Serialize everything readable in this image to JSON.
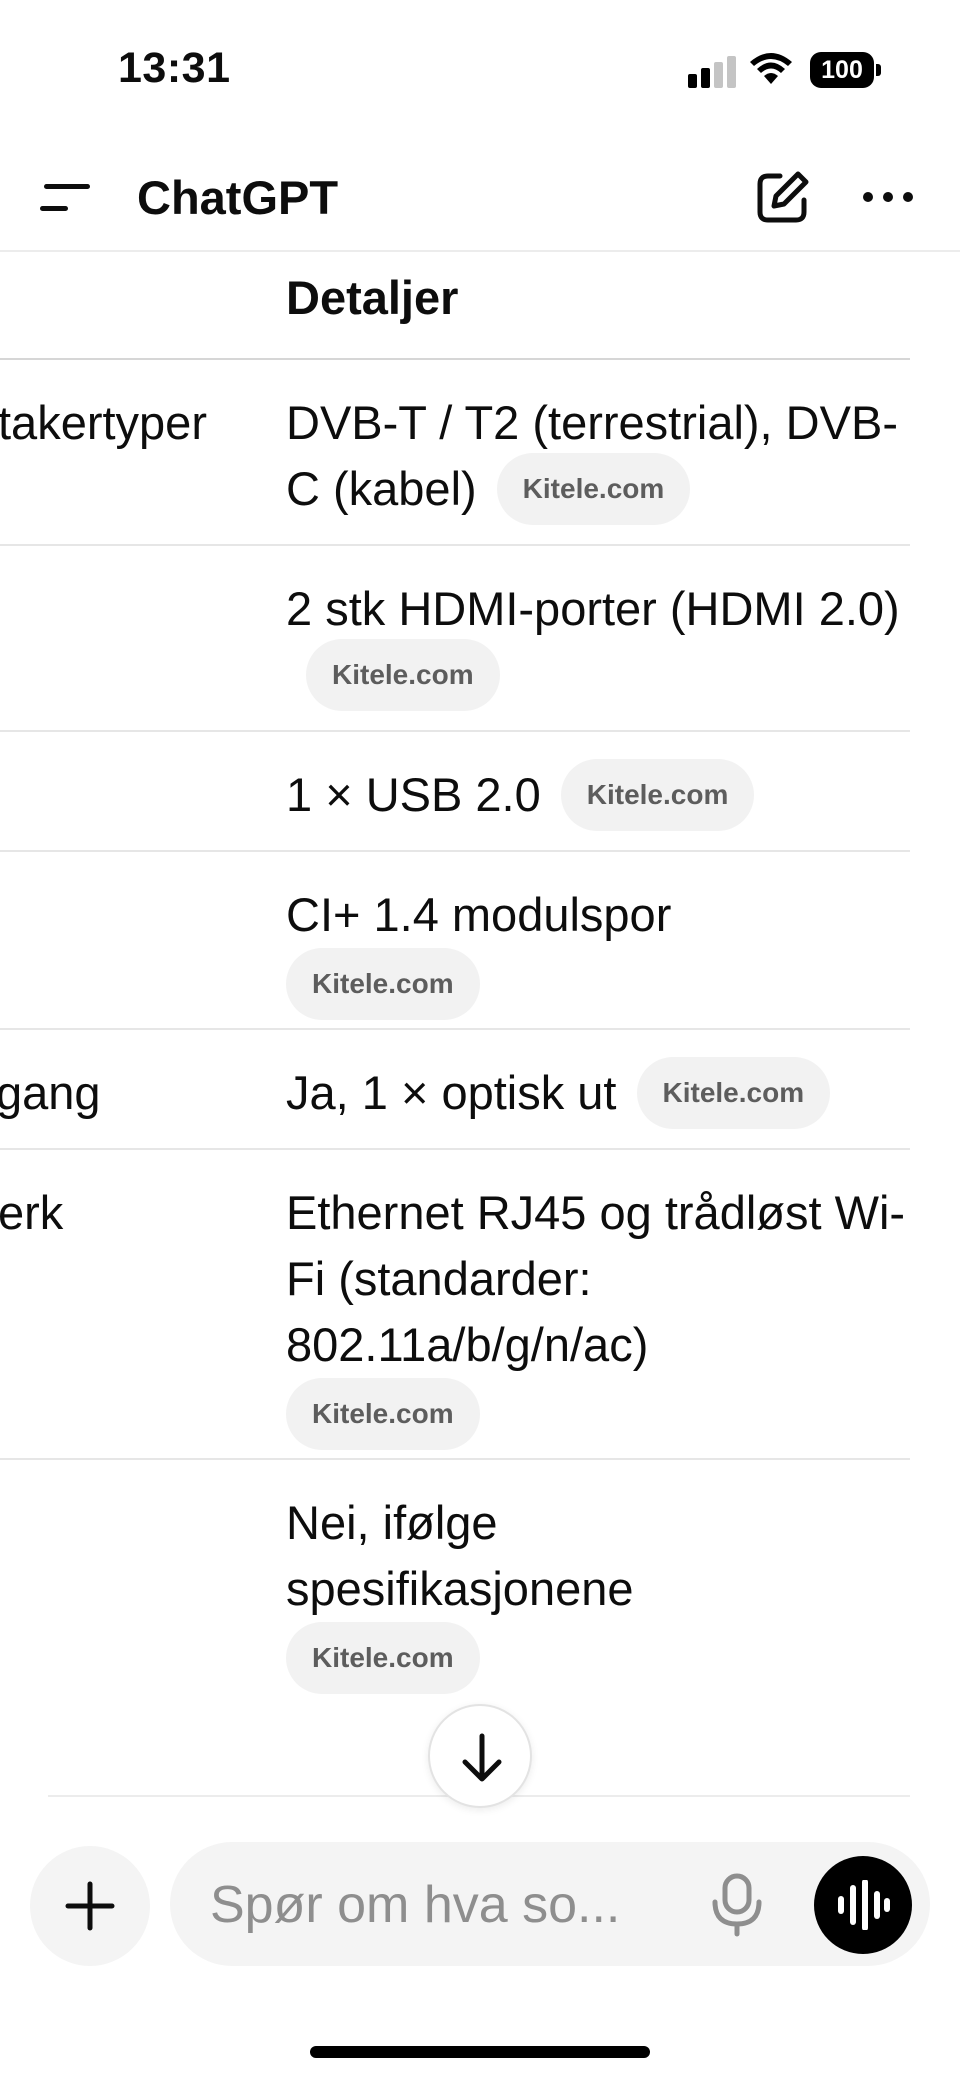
{
  "status_bar": {
    "time": "13:31",
    "battery": "100"
  },
  "header": {
    "title": "ChatGPT"
  },
  "table": {
    "details_header": "Detaljer",
    "rows": [
      {
        "label": "takertyper",
        "value": "DVB-T / T2 (terrestrial), DVB-C (kabel)",
        "source": "Kitele.com"
      },
      {
        "label": "",
        "value": "2 stk HDMI-porter (HDMI 2.0)",
        "source": "Kitele.com"
      },
      {
        "label": "",
        "value": "1 × USB 2.0",
        "source": "Kitele.com"
      },
      {
        "label": "",
        "value": "CI+ 1.4 modulspor",
        "source": "Kitele.com"
      },
      {
        "label": "gang",
        "value": "Ja, 1 × optisk ut",
        "source": "Kitele.com"
      },
      {
        "label": "erk",
        "value": "Ethernet RJ45 og trådløst Wi-Fi (standarder: 802.11a/b/g/n/ac)",
        "source": "Kitele.com"
      },
      {
        "label": "",
        "value": "Nei, ifølge spesifikasjonene",
        "source": "Kitele.com"
      }
    ]
  },
  "composer": {
    "placeholder": "Spør om hva so..."
  },
  "icons": {
    "menu": "menu-icon",
    "new_chat": "pencil-square-icon",
    "more": "ellipsis-icon",
    "scroll_down": "arrow-down-icon",
    "add": "plus-icon",
    "mic": "microphone-icon",
    "voice": "waveform-icon"
  }
}
